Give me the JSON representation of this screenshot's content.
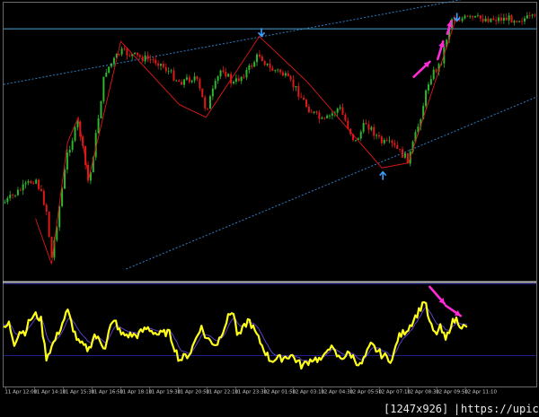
{
  "watermark": {
    "size": "[1247x926]",
    "separator": "|",
    "url": "https://upic.me/"
  },
  "colors": {
    "background": "#000000",
    "bull_candle": "#2db52d",
    "bear_candle": "#e01818",
    "zigzag": "#e01818",
    "channel": "#2f7ec9",
    "horizontal_level": "#4aa3d6",
    "oscillator_main": "#ffff1a",
    "oscillator_signal": "#5b3fc9",
    "oscillator_level": "#1c1c8a",
    "divergence_arrow": "#ff2bd6",
    "fractal_arrow": "#3ea0ff"
  },
  "chart_data": [
    {
      "type": "candlestick",
      "panel": "price",
      "x": [
        "11 Apr 12:00",
        "11 Apr 14:10",
        "11 Apr 15:30",
        "11 Apr 16:50",
        "11 Apr 18:10",
        "11 Apr 19:30",
        "11 Apr 20:50",
        "11 Apr 22:10",
        "11 Apr 23:30",
        "12 Apr 01:50",
        "12 Apr 03:10",
        "12 Apr 04:30",
        "12 Apr 05:50",
        "12 Apr 07:10",
        "12 Apr 08:30",
        "12 Apr 09:50",
        "12 Apr 11:10"
      ],
      "close_path": [
        [
          0,
          0.26
        ],
        [
          0.03,
          0.31
        ],
        [
          0.06,
          0.36
        ],
        [
          0.08,
          0.24
        ],
        [
          0.09,
          0.04
        ],
        [
          0.12,
          0.46
        ],
        [
          0.14,
          0.58
        ],
        [
          0.16,
          0.33
        ],
        [
          0.19,
          0.78
        ],
        [
          0.22,
          0.86
        ],
        [
          0.25,
          0.84
        ],
        [
          0.29,
          0.82
        ],
        [
          0.33,
          0.74
        ],
        [
          0.36,
          0.76
        ],
        [
          0.38,
          0.63
        ],
        [
          0.41,
          0.8
        ],
        [
          0.43,
          0.73
        ],
        [
          0.46,
          0.79
        ],
        [
          0.48,
          0.85
        ],
        [
          0.5,
          0.79
        ],
        [
          0.52,
          0.78
        ],
        [
          0.55,
          0.71
        ],
        [
          0.57,
          0.64
        ],
        [
          0.6,
          0.58
        ],
        [
          0.63,
          0.64
        ],
        [
          0.66,
          0.5
        ],
        [
          0.68,
          0.58
        ],
        [
          0.71,
          0.5
        ],
        [
          0.73,
          0.49
        ],
        [
          0.76,
          0.43
        ],
        [
          0.78,
          0.58
        ],
        [
          0.8,
          0.76
        ],
        [
          0.82,
          0.81
        ],
        [
          0.84,
          0.99
        ]
      ],
      "zigzag": [
        [
          0.06,
          0.2
        ],
        [
          0.09,
          0.02
        ],
        [
          0.12,
          0.5
        ],
        [
          0.14,
          0.6
        ],
        [
          0.16,
          0.36
        ],
        [
          0.22,
          0.9
        ],
        [
          0.33,
          0.65
        ],
        [
          0.38,
          0.6
        ],
        [
          0.48,
          0.92
        ],
        [
          0.57,
          0.74
        ],
        [
          0.71,
          0.4
        ],
        [
          0.76,
          0.42
        ],
        [
          0.85,
          0.995
        ]
      ],
      "fractal_arrows": [
        {
          "direction": "down",
          "at": [
            0.484,
            0.935
          ]
        },
        {
          "direction": "up",
          "at": [
            0.712,
            0.37
          ]
        },
        {
          "direction": "down",
          "at": [
            0.851,
            0.995
          ]
        }
      ],
      "divergence_arrows": [
        [
          [
            0.77,
            0.76
          ],
          [
            0.8,
            0.82
          ]
        ],
        [
          [
            0.815,
            0.83
          ],
          [
            0.825,
            0.9
          ]
        ],
        [
          [
            0.833,
            0.93
          ],
          [
            0.84,
            0.98
          ]
        ]
      ],
      "trend_lines": [
        {
          "style": "dotted",
          "from": [
            0.0,
            0.73
          ],
          "to": [
            1.0,
            1.12
          ]
        },
        {
          "style": "dotted",
          "from": [
            0.23,
            0.0
          ],
          "to": [
            1.0,
            0.68
          ]
        },
        {
          "style": "solid",
          "from": [
            0.0,
            0.95
          ],
          "to": [
            1.0,
            0.95
          ]
        }
      ]
    },
    {
      "type": "line",
      "panel": "oscillator",
      "series": [
        {
          "role": "main",
          "values": [
            [
              0,
              0.48
            ],
            [
              0.01,
              0.55
            ],
            [
              0.02,
              0.32
            ],
            [
              0.03,
              0.46
            ],
            [
              0.04,
              0.45
            ],
            [
              0.05,
              0.6
            ],
            [
              0.06,
              0.65
            ],
            [
              0.07,
              0.6
            ],
            [
              0.08,
              0.15
            ],
            [
              0.1,
              0.4
            ],
            [
              0.12,
              0.7
            ],
            [
              0.13,
              0.5
            ],
            [
              0.14,
              0.33
            ],
            [
              0.16,
              0.24
            ],
            [
              0.17,
              0.42
            ],
            [
              0.19,
              0.27
            ],
            [
              0.2,
              0.51
            ],
            [
              0.21,
              0.58
            ],
            [
              0.22,
              0.42
            ],
            [
              0.25,
              0.41
            ],
            [
              0.27,
              0.5
            ],
            [
              0.29,
              0.42
            ],
            [
              0.31,
              0.45
            ],
            [
              0.33,
              0.12
            ],
            [
              0.35,
              0.2
            ],
            [
              0.37,
              0.52
            ],
            [
              0.38,
              0.38
            ],
            [
              0.4,
              0.3
            ],
            [
              0.42,
              0.6
            ],
            [
              0.43,
              0.72
            ],
            [
              0.44,
              0.38
            ],
            [
              0.46,
              0.6
            ],
            [
              0.48,
              0.35
            ],
            [
              0.5,
              0.12
            ],
            [
              0.52,
              0.14
            ],
            [
              0.54,
              0.18
            ],
            [
              0.56,
              0.05
            ],
            [
              0.58,
              0.14
            ],
            [
              0.6,
              0.12
            ],
            [
              0.61,
              0.3
            ],
            [
              0.63,
              0.14
            ],
            [
              0.65,
              0.2
            ],
            [
              0.67,
              0.05
            ],
            [
              0.69,
              0.3
            ],
            [
              0.71,
              0.18
            ],
            [
              0.73,
              0.12
            ],
            [
              0.74,
              0.38
            ],
            [
              0.76,
              0.5
            ],
            [
              0.78,
              0.7
            ],
            [
              0.79,
              0.83
            ],
            [
              0.8,
              0.55
            ],
            [
              0.81,
              0.42
            ],
            [
              0.82,
              0.5
            ],
            [
              0.83,
              0.35
            ],
            [
              0.84,
              0.55
            ],
            [
              0.85,
              0.6
            ],
            [
              0.86,
              0.52
            ],
            [
              0.87,
              0.49
            ]
          ]
        },
        {
          "role": "signal",
          "values": "smoothed main"
        }
      ],
      "levels": [
        "upper",
        "lower"
      ]
    }
  ],
  "time_ticks": [
    "11 Apr 12:00",
    "11 Apr 14:10",
    "11 Apr 15:30",
    "11 Apr 16:50",
    "11 Apr 18:10",
    "11 Apr 19:30",
    "11 Apr 20:50",
    "11 Apr 22:10",
    "11 Apr 23:30",
    "12 Apr 01:50",
    "12 Apr 03:10",
    "12 Apr 04:30",
    "12 Apr 05:50",
    "12 Apr 07:10",
    "12 Apr 08:30",
    "12 Apr 09:50",
    "12 Apr 11:10"
  ]
}
